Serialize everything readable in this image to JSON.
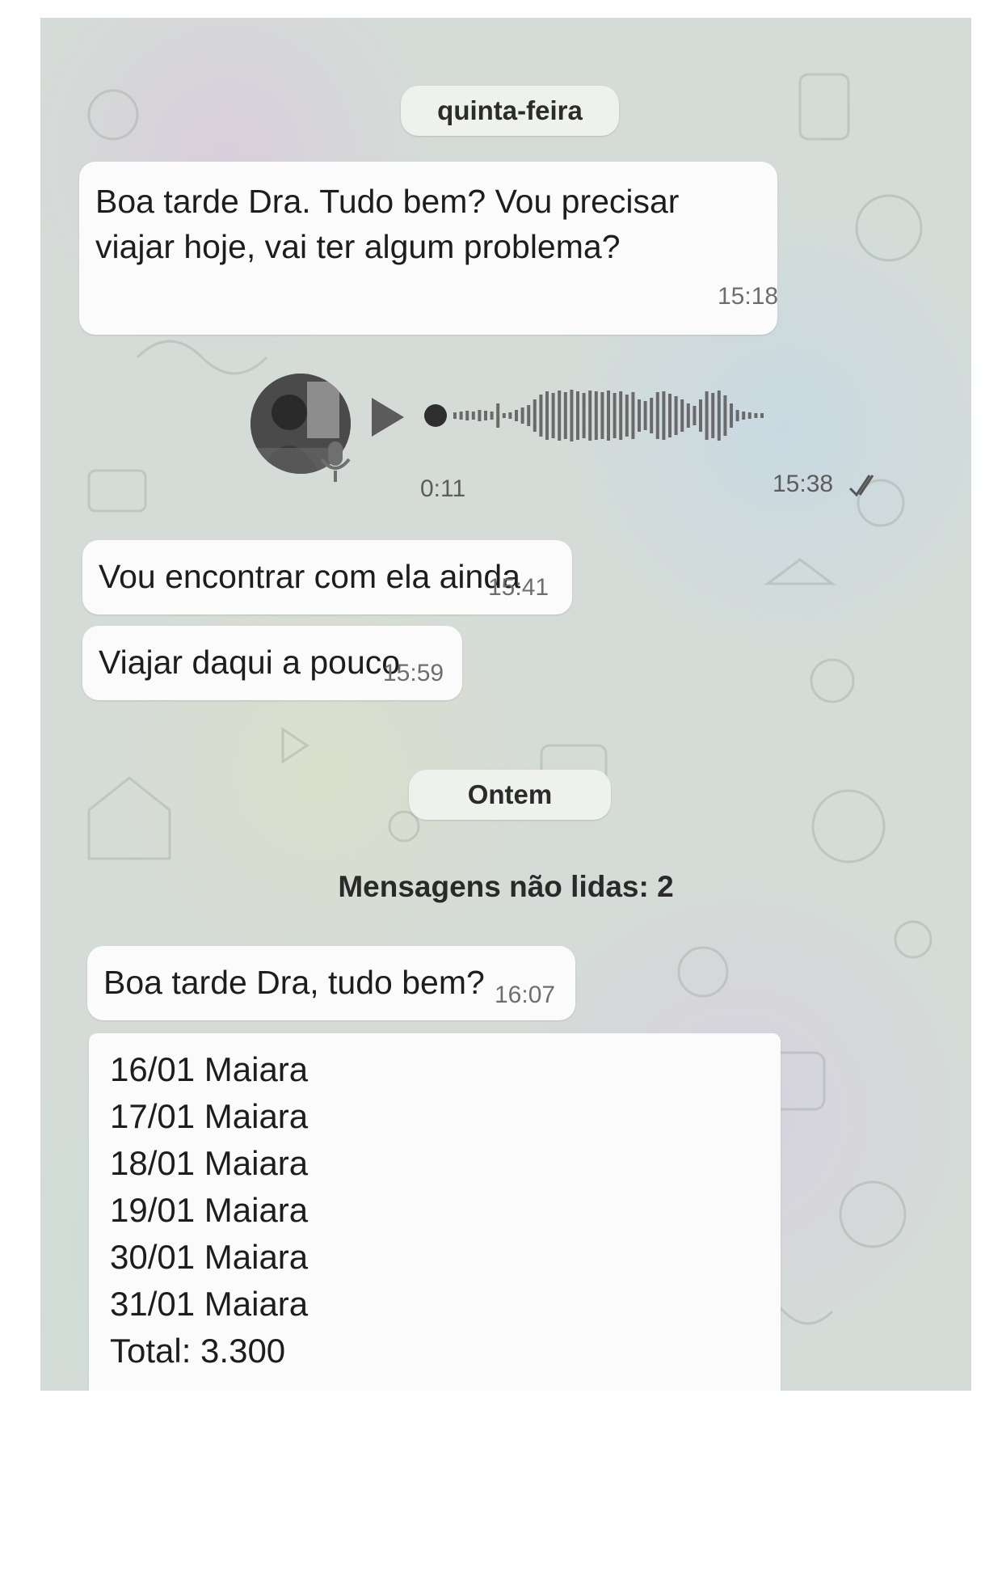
{
  "date_separators": {
    "first": "quinta-feira",
    "second": "Ontem"
  },
  "messages": {
    "m1": {
      "text_line1": "Boa tarde Dra. Tudo bem? Vou precisar",
      "text_line2": "viajar hoje, vai ter algum problema?",
      "time": "15:18"
    },
    "voice": {
      "duration": "0:11",
      "time": "15:38",
      "status_icon": "double-check-icon"
    },
    "m2": {
      "text": "Vou encontrar com ela ainda",
      "time": "15:41"
    },
    "m3": {
      "text": "Viajar daqui a pouco",
      "time": "15:59"
    },
    "m4": {
      "text": "Boa tarde Dra, tudo bem?",
      "time": "16:07"
    },
    "m5": {
      "lines": [
        "16/01 Maiara",
        "17/01 Maiara",
        "18/01 Maiara",
        "19/01 Maiara",
        "30/01 Maiara",
        "31/01 Maiara",
        "Total: 3.300"
      ]
    }
  },
  "unread_banner": "Mensagens não lidas: 2",
  "colors": {
    "bubble": "#fbfbfb",
    "pill": "#eef1ec",
    "text": "#1d1d1d",
    "time": "#6e6e6e"
  }
}
